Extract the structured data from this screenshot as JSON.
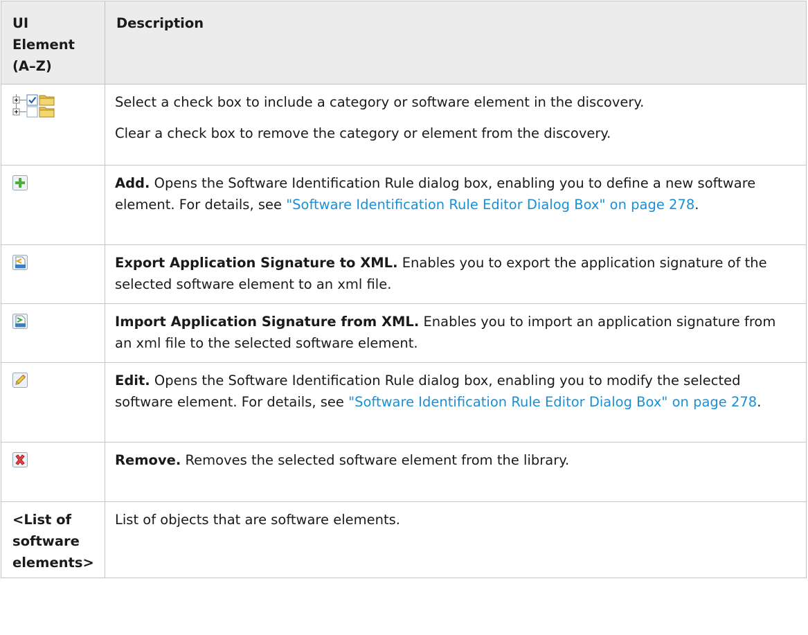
{
  "table": {
    "headers": [
      "UI Element (A–Z)",
      "Description"
    ],
    "rows": [
      {
        "element_icons": [
          "expand-tree-icon",
          "checked-checkbox-icon",
          "folder-icon",
          "expand-tree-icon",
          "unchecked-checkbox-icon",
          "folder-icon"
        ],
        "paragraphs": [
          "Select a check box to include a category or software element in the discovery.",
          "Clear a check box to remove the category or element from the discovery."
        ]
      },
      {
        "element_icon": "add-icon",
        "title": "Add.",
        "text": " Opens the Software Identification Rule dialog box, enabling you to define a new software element. For details, see ",
        "link": "\"Software Identification Rule Editor Dialog Box\" on page 278",
        "tail": "."
      },
      {
        "element_icon": "export-xml-icon",
        "title": "Export Application Signature to XML.",
        "text": " Enables you to export the application signature of the selected software element to an xml file."
      },
      {
        "element_icon": "import-xml-icon",
        "title": "Import Application Signature from XML.",
        "text": " Enables you to import an application signature from an xml file to the selected software element."
      },
      {
        "element_icon": "edit-pencil-icon",
        "title": "Edit.",
        "text": " Opens the Software Identification Rule dialog box, enabling you to modify the selected software element. For details, see ",
        "link": "\"Software Identification Rule Editor Dialog Box\" on page 278",
        "tail": "."
      },
      {
        "element_icon": "remove-icon",
        "title": "Remove.",
        "text": " Removes the selected software element from the library."
      },
      {
        "element": "<List of software elements>",
        "text": "List of objects that are software elements."
      }
    ]
  },
  "colors": {
    "link": "#1a8fd6",
    "header_bg": "#ececec",
    "border": "#c4c4c4"
  }
}
